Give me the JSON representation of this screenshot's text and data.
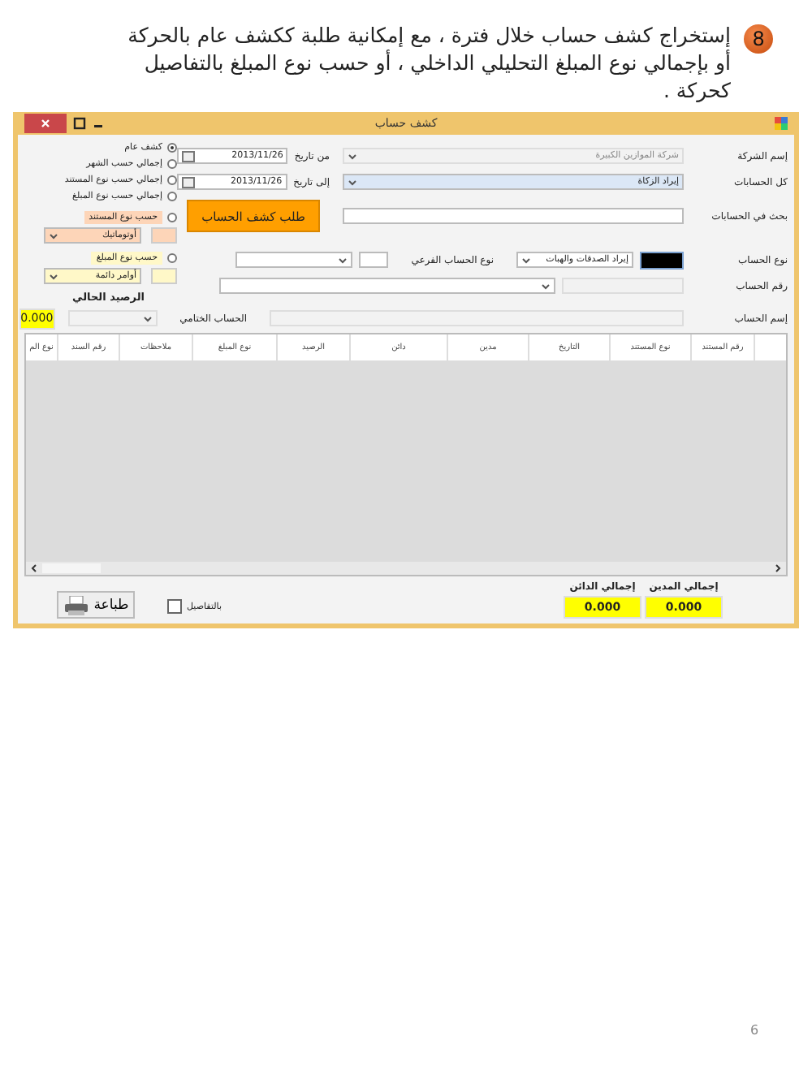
{
  "document": {
    "step": "8",
    "paragraph": "إستخراج كشف حساب خلال فترة ، مع إمكانية طلبة ككشف عام بالحركة أو بإجمالي نوع المبلغ التحليلي الداخلي ، أو حسب نوع المبلغ بالتفاصيل كحركة .",
    "page_number": "6"
  },
  "window": {
    "title": "كشف حساب"
  },
  "form": {
    "company": {
      "label": "إسم الشركة",
      "value": "شركة الموازين الكبيرة"
    },
    "accounts": {
      "label": "كل الحسابات",
      "value": "إيراد الزكاة"
    },
    "from_date": {
      "label": "من تاريخ",
      "value": "2013/11/26"
    },
    "to_date": {
      "label": "إلى تاريخ",
      "value": "2013/11/26"
    },
    "request_button": "طلب كشف الحساب",
    "search": {
      "label": "بحث في الحسابات"
    },
    "account_type": {
      "label": "نوع الحساب",
      "value": "إيراد الصدقات والهبات"
    },
    "sub_type": {
      "label": "نوع الحساب الفرعي"
    },
    "account_number": {
      "label": "رقم الحساب"
    },
    "account_name": {
      "label": "إسم الحساب"
    },
    "closing_account": {
      "label": "الحساب الختامي"
    }
  },
  "report_options": [
    {
      "label": "كشف عام",
      "selected": true
    },
    {
      "label": "إجمالي حسب الشهر",
      "selected": false
    },
    {
      "label": "إجمالي حسب نوع المستند",
      "selected": false
    },
    {
      "label": "إجمالي حسب نوع المبلغ",
      "selected": false
    }
  ],
  "filters": [
    {
      "label": "حسب نوع المستند",
      "selected": false,
      "value": "أوتوماتيك",
      "color": "#fdd5b8"
    },
    {
      "label": "حسب نوع المبلغ",
      "selected": false,
      "value": "أوامر دائمة",
      "color": "#fff8c8"
    }
  ],
  "balance": {
    "label": "الرصيد الحالي",
    "value": "0.000"
  },
  "table": {
    "columns": [
      "رقم المستند",
      "نوع المستند",
      "التاريخ",
      "مدين",
      "دائن",
      "الرصيد",
      "نوع المبلغ",
      "ملاحظات",
      "رقم السند",
      "نوع الم"
    ]
  },
  "totals": [
    {
      "label": "إجمالي المدين",
      "value": "0.000"
    },
    {
      "label": "إجمالي الدائن",
      "value": "0.000"
    }
  ],
  "details_checkbox": {
    "label": "بالتفاصيل",
    "checked": false
  },
  "print_button": "طباعة"
}
